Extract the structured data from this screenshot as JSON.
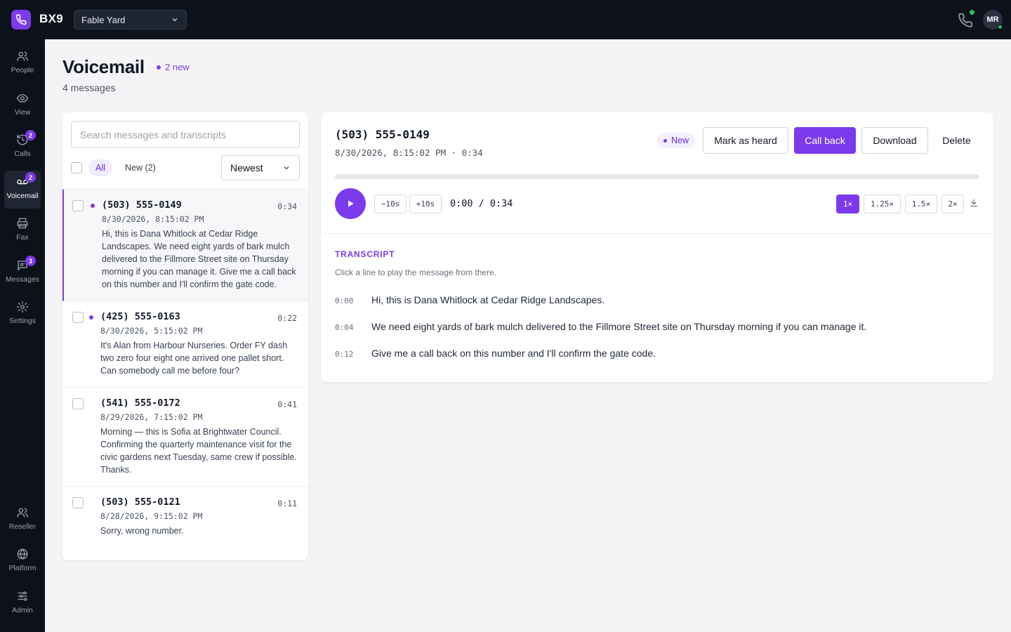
{
  "app": {
    "brand": "BX9",
    "org": "Fable Yard",
    "user_initials": "MR"
  },
  "nav": {
    "top": [
      {
        "label": "People",
        "badge": ""
      },
      {
        "label": "View",
        "badge": ""
      },
      {
        "label": "Calls",
        "badge": "2"
      },
      {
        "label": "Voicemail",
        "badge": "2"
      },
      {
        "label": "Fax",
        "badge": ""
      },
      {
        "label": "Messages",
        "badge": "3"
      },
      {
        "label": "Settings",
        "badge": ""
      }
    ],
    "bottom": [
      {
        "label": "Reseller"
      },
      {
        "label": "Platform"
      },
      {
        "label": "Admin"
      }
    ]
  },
  "header": {
    "title": "Voicemail",
    "new_label": "2 new",
    "subtitle": "4 messages"
  },
  "list": {
    "search_placeholder": "Search messages and transcripts",
    "filter_all": "All",
    "filter_new": "New (2)",
    "sort": "Newest",
    "items": [
      {
        "phone": "(503) 555-0149",
        "duration": "0:34",
        "date": "8/30/2026, 8:15:02 PM",
        "snippet": "Hi, this is Dana Whitlock at Cedar Ridge Landscapes. We need eight yards of bark mulch delivered to the Fillmore Street site on Thursday morning if you can manage it. Give me a call back on this number and I'll confirm the gate code."
      },
      {
        "phone": "(425) 555-0163",
        "duration": "0:22",
        "date": "8/30/2026, 5:15:02 PM",
        "snippet": "It's Alan from Harbour Nurseries. Order FY dash two zero four eight one arrived one pallet short. Can somebody call me before four?"
      },
      {
        "phone": "(541) 555-0172",
        "duration": "0:41",
        "date": "8/29/2026, 7:15:02 PM",
        "snippet": "Morning — this is Sofia at Brightwater Council. Confirming the quarterly maintenance visit for the civic gardens next Tuesday, same crew if possible. Thanks."
      },
      {
        "phone": "(503) 555-0121",
        "duration": "0:11",
        "date": "8/28/2026, 9:15:02 PM",
        "snippet": "Sorry, wrong number."
      }
    ]
  },
  "detail": {
    "phone": "(503) 555-0149",
    "meta": "8/30/2026, 8:15:02 PM · 0:34",
    "status": "New",
    "buttons": {
      "mark": "Mark as heard",
      "call": "Call back",
      "download": "Download",
      "delete": "Delete"
    },
    "player": {
      "back": "−10s",
      "fwd": "+10s",
      "time": "0:00 / 0:34",
      "speeds": [
        "1×",
        "1.25×",
        "1.5×",
        "2×"
      ],
      "active_speed": "1×",
      "progress": 0
    },
    "transcript": {
      "title": "TRANSCRIPT",
      "hint": "Click a line to play the message from there.",
      "lines": [
        {
          "t": "0:00",
          "text": "Hi, this is Dana Whitlock at Cedar Ridge Landscapes."
        },
        {
          "t": "0:04",
          "text": "We need eight yards of bark mulch delivered to the Fillmore Street site on Thursday morning if you can manage it."
        },
        {
          "t": "0:12",
          "text": "Give me a call back on this number and I'll confirm the gate code."
        }
      ]
    }
  },
  "colors": {
    "accent": "#7c3aed",
    "chrome": "#0d111a",
    "online": "#22c55e"
  }
}
